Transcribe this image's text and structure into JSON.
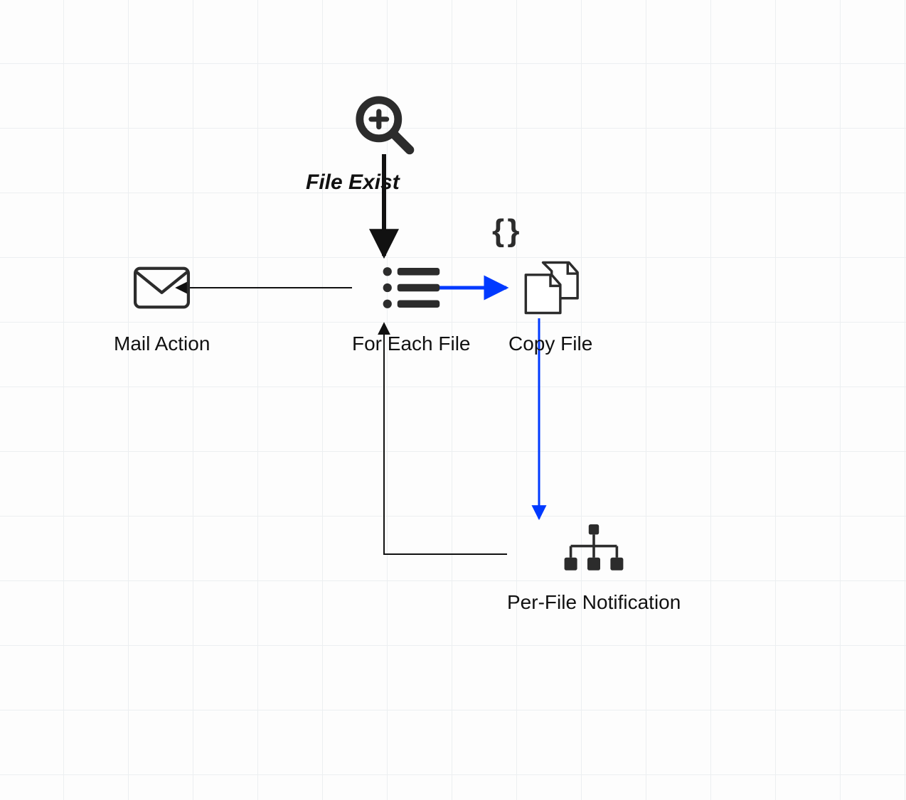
{
  "nodes": {
    "trigger": {
      "label": "File Exist"
    },
    "mail": {
      "label": "Mail Action"
    },
    "foreach": {
      "label": "For Each File"
    },
    "copy": {
      "label": "Copy File"
    },
    "notify": {
      "label": "Per-File Notification"
    }
  },
  "badges": {
    "json": "{ }"
  },
  "edges": [
    {
      "from": "trigger",
      "to": "foreach",
      "color": "black"
    },
    {
      "from": "foreach",
      "to": "copy",
      "color": "blue"
    },
    {
      "from": "foreach",
      "to": "mail",
      "color": "black"
    },
    {
      "from": "copy",
      "to": "notify",
      "color": "blue"
    },
    {
      "from": "notify",
      "to": "foreach",
      "color": "black"
    }
  ]
}
